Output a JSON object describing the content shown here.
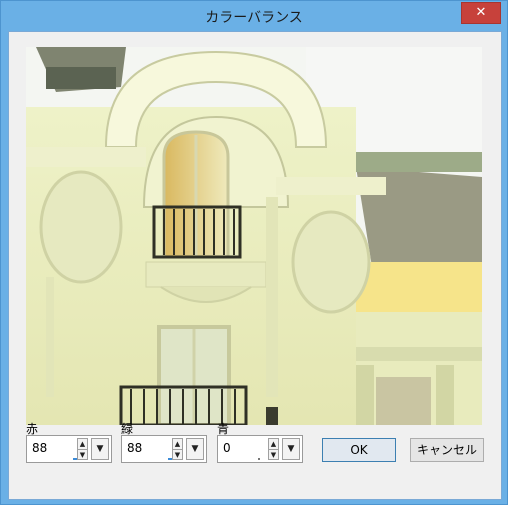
{
  "window": {
    "title": "カラーバランス",
    "close_symbol": "✕"
  },
  "colors": {
    "title_bar": "#6ab0e6",
    "close_button": "#c7413b",
    "client_bg": "#f0f0f0"
  },
  "controls": {
    "red": {
      "label": "赤",
      "value": "88"
    },
    "green": {
      "label": "緑",
      "value": "88"
    },
    "blue": {
      "label": "青",
      "value": "0"
    },
    "spin_up": "▲",
    "spin_down": "▼",
    "dropdown": "▼"
  },
  "buttons": {
    "ok": "OK",
    "cancel": "キャンセル"
  },
  "icons": {
    "close": "close-icon",
    "spin": "spin-arrows-icon",
    "dropdown": "dropdown-arrow-icon"
  }
}
